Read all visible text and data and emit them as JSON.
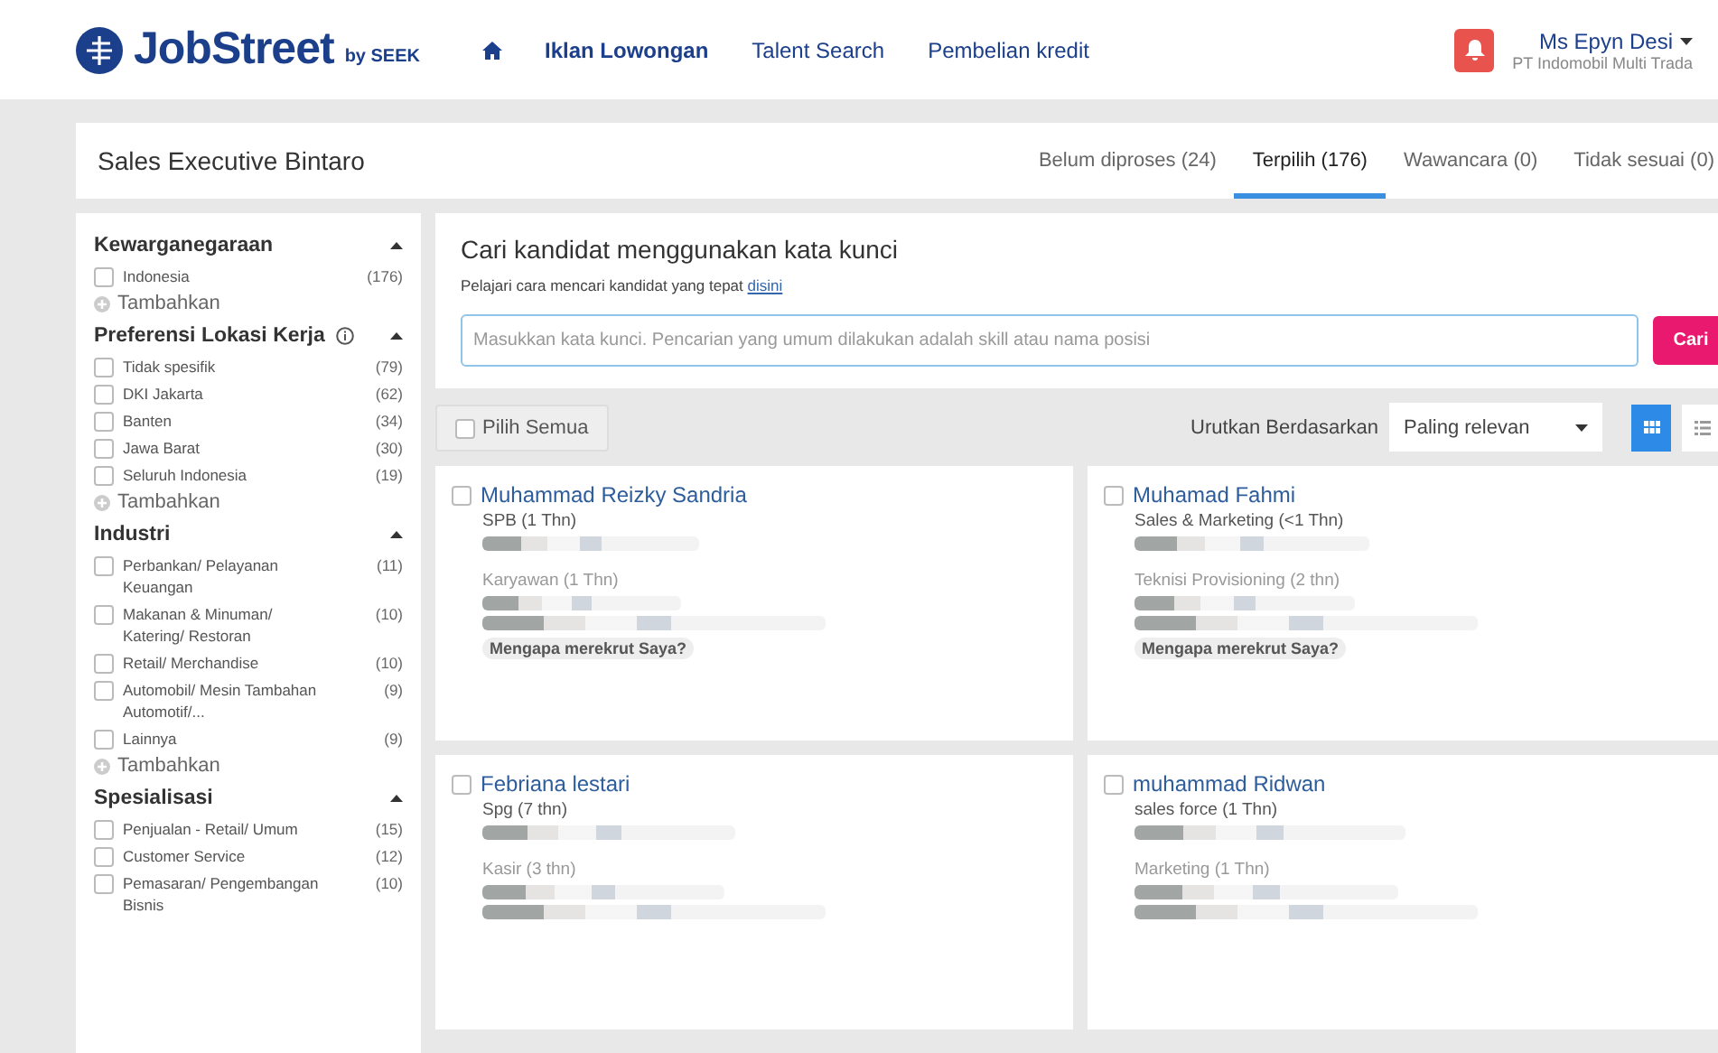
{
  "header": {
    "logo": "JobStreet",
    "logo_suffix": "by SEEK",
    "nav": [
      {
        "label": "Iklan Lowongan",
        "selected": true
      },
      {
        "label": "Talent Search",
        "selected": false
      },
      {
        "label": "Pembelian kredit",
        "selected": false
      }
    ],
    "user": {
      "name": "Ms Epyn Desi",
      "company": "PT Indomobil Multi Trada"
    }
  },
  "job": {
    "title": "Sales Executive Bintaro",
    "tabs": [
      {
        "label": "Belum diproses (24)",
        "selected": false
      },
      {
        "label": "Terpilih (176)",
        "selected": true
      },
      {
        "label": "Wawancara (0)",
        "selected": false
      },
      {
        "label": "Tidak sesuai (0)",
        "selected": false
      }
    ]
  },
  "sidebar": {
    "groups": [
      {
        "title": "Kewarganegaraan",
        "info": false,
        "expanded": true,
        "items": [
          {
            "label": "Indonesia",
            "count": "(176)",
            "checked": false
          }
        ],
        "add": "Tambahkan"
      },
      {
        "title": "Preferensi Lokasi Kerja",
        "info": true,
        "expanded": true,
        "items": [
          {
            "label": "Tidak spesifik",
            "count": "(79)",
            "checked": false
          },
          {
            "label": "DKI Jakarta",
            "count": "(62)",
            "checked": false
          },
          {
            "label": "Banten",
            "count": "(34)",
            "checked": false
          },
          {
            "label": "Jawa Barat",
            "count": "(30)",
            "checked": false
          },
          {
            "label": "Seluruh Indonesia",
            "count": "(19)",
            "checked": false
          }
        ],
        "add": "Tambahkan"
      },
      {
        "title": "Industri",
        "info": false,
        "expanded": true,
        "items": [
          {
            "label": "Perbankan/ Pelayanan Keuangan",
            "count": "(11)",
            "checked": false
          },
          {
            "label": "Makanan & Minuman/ Katering/ Restoran",
            "count": "(10)",
            "checked": false
          },
          {
            "label": "Retail/ Merchandise",
            "count": "(10)",
            "checked": false
          },
          {
            "label": "Automobil/ Mesin Tambahan Automotif/...",
            "count": "(9)",
            "checked": false
          },
          {
            "label": "Lainnya",
            "count": "(9)",
            "checked": false
          }
        ],
        "add": "Tambahkan"
      },
      {
        "title": "Spesialisasi",
        "info": false,
        "expanded": true,
        "items": [
          {
            "label": "Penjualan - Retail/ Umum",
            "count": "(15)",
            "checked": false
          },
          {
            "label": "Customer Service",
            "count": "(12)",
            "checked": false
          },
          {
            "label": "Pemasaran/ Pengembangan Bisnis",
            "count": "(10)",
            "checked": false
          }
        ]
      }
    ]
  },
  "search": {
    "heading": "Cari kandidat menggunakan kata kunci",
    "hint": "Pelajari cara mencari kandidat yang tepat",
    "hint_link": "disini",
    "placeholder": "Masukkan kata kunci. Pencarian yang umum dilakukan adalah skill atau nama posisi",
    "button": "Cari"
  },
  "toolbar": {
    "select_all": {
      "label": "Pilih Semua",
      "checked": false
    },
    "sort_label": "Urutkan Berdasarkan",
    "sort_value": "Paling relevan",
    "views": [
      {
        "kind": "grid",
        "selected": true
      },
      {
        "kind": "list",
        "selected": false
      }
    ]
  },
  "candidates": [
    {
      "name": "Muhammad Reizky Sandria",
      "checked": false,
      "jobs": [
        {
          "title": "SPB (1 Thn)",
          "kind": "current"
        },
        {
          "title": "Karyawan (1 Thn)",
          "kind": "past"
        }
      ],
      "why": "Mengapa merekrut Saya?"
    },
    {
      "name": "Muhamad Fahmi",
      "checked": false,
      "jobs": [
        {
          "title": "Sales & Marketing (<1 Thn)",
          "kind": "current"
        },
        {
          "title": "Teknisi Provisioning (2 thn)",
          "kind": "past"
        }
      ],
      "why": "Mengapa merekrut Saya?"
    },
    {
      "name": "Febriana lestari",
      "checked": false,
      "jobs": [
        {
          "title": "Spg (7 thn)",
          "kind": "current"
        },
        {
          "title": "Kasir (3 thn)",
          "kind": "past"
        }
      ]
    },
    {
      "name": "muhammad Ridwan",
      "checked": false,
      "jobs": [
        {
          "title": "sales force (1 Thn)",
          "kind": "current"
        },
        {
          "title": "Marketing (1 Thn)",
          "kind": "past"
        }
      ]
    }
  ]
}
